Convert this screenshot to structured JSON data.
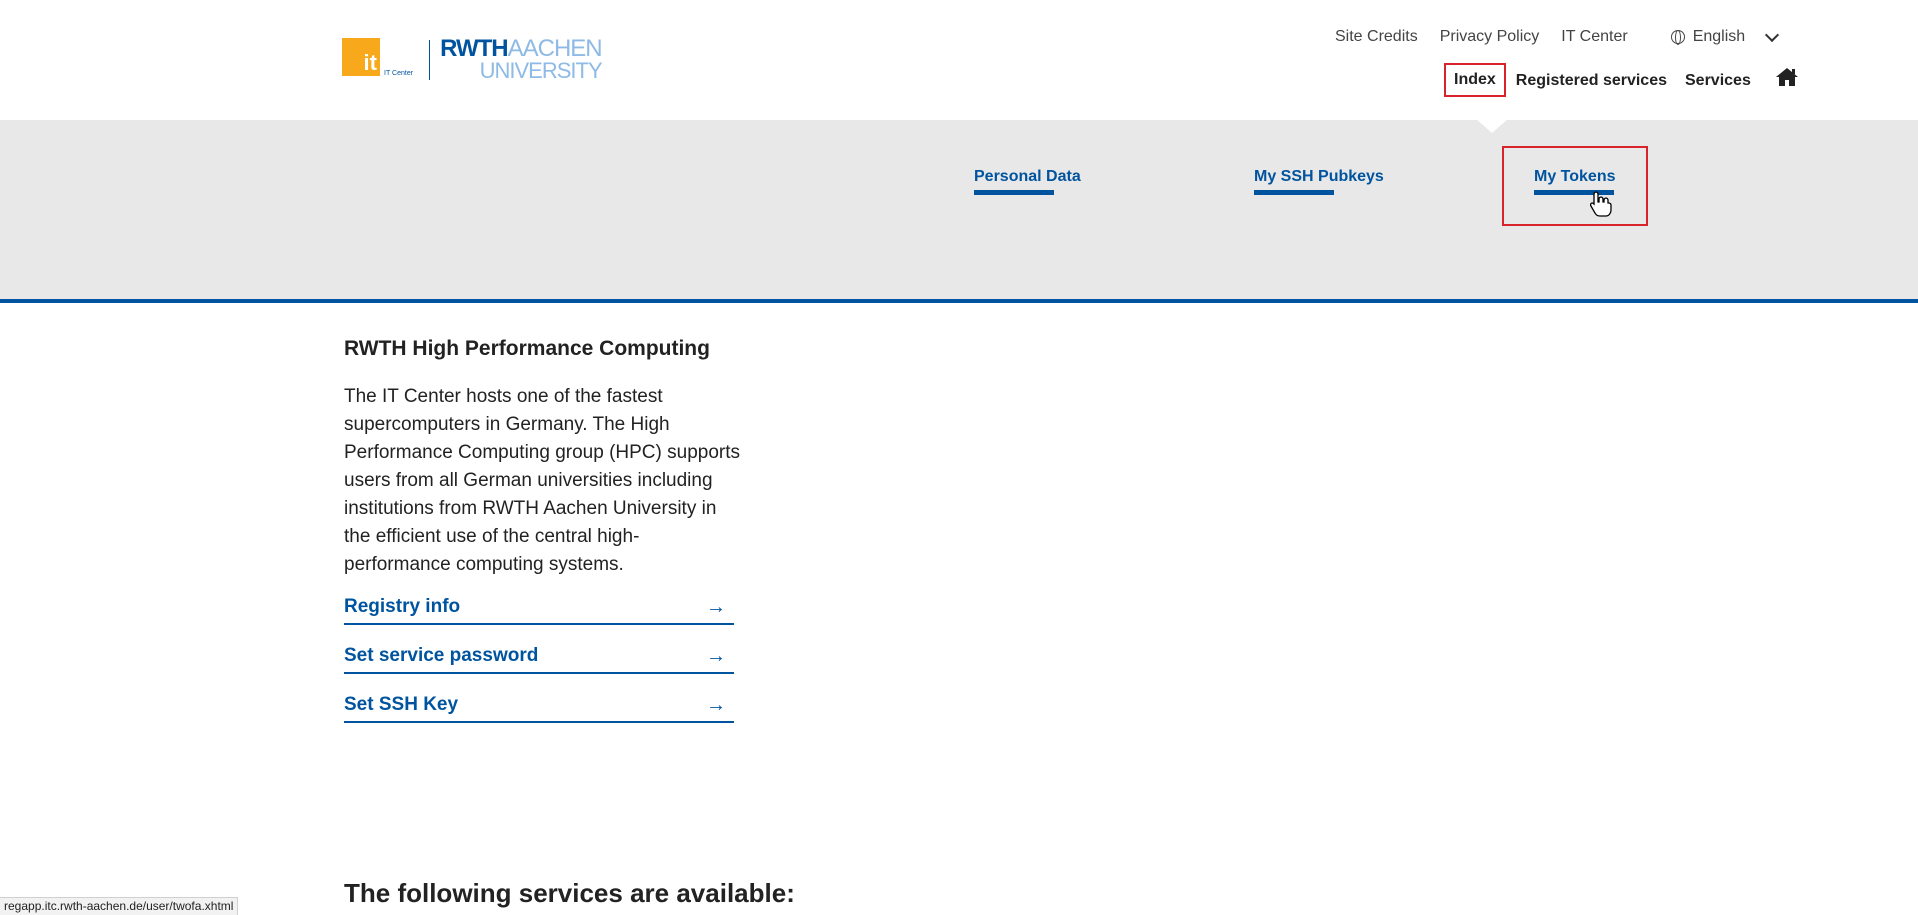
{
  "header": {
    "logo": {
      "it_mark": "it",
      "it_center": "IT Center",
      "rwth": "RWTH",
      "aachen": "AACHEN",
      "university": "UNIVERSITY"
    },
    "meta_nav": {
      "site_credits": "Site Credits",
      "privacy_policy": "Privacy Policy",
      "it_center": "IT Center",
      "language": "English"
    },
    "main_nav": {
      "index": "Index",
      "registered_services": "Registered services",
      "services": "Services"
    }
  },
  "subnav": {
    "personal_data": "Personal Data",
    "ssh_pubkeys": "My SSH Pubkeys",
    "tokens": "My Tokens"
  },
  "content": {
    "title": "RWTH High Performance Computing",
    "description": "The IT Center hosts one of the fastest supercomputers in Germany. The High Performance Computing group (HPC) supports users from all German universities including institutions from RWTH Aachen University in the efficient use of the central high-performance computing systems.",
    "links": [
      {
        "label": "Registry info"
      },
      {
        "label": "Set service password"
      },
      {
        "label": "Set SSH Key"
      }
    ],
    "arrow_glyph": "→"
  },
  "services_heading": "The following services are available:",
  "status_url": "regapp.itc.rwth-aachen.de/user/twofa.xhtml",
  "colors": {
    "rwth_blue": "#00549f",
    "light_blue": "#8ebae5",
    "it_orange": "#f8a81b",
    "highlight_red": "#d9232a",
    "band_gray": "#e8e8e8"
  }
}
